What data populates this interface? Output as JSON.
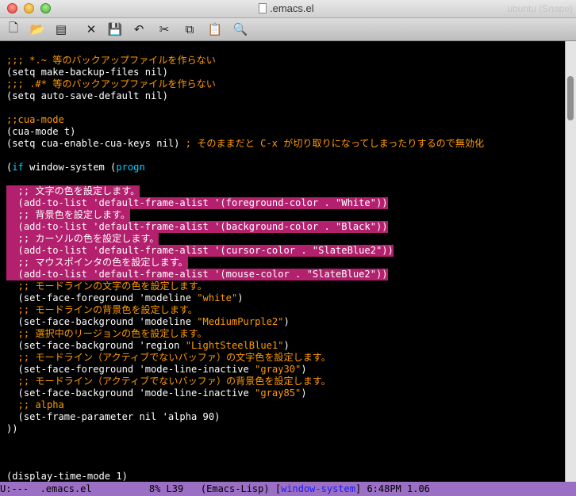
{
  "window": {
    "title": ".emacs.el",
    "ghost_text": "ubuntu (Snape)"
  },
  "toolbar": [
    {
      "name": "new-file-icon",
      "glyph": "🗋"
    },
    {
      "name": "open-folder-icon",
      "glyph": "📂"
    },
    {
      "name": "dired-icon",
      "glyph": "▤"
    },
    {
      "name": "close-buffer-icon",
      "glyph": "✕"
    },
    {
      "name": "save-icon",
      "glyph": "💾"
    },
    {
      "name": "undo-icon",
      "glyph": "↶"
    },
    {
      "name": "cut-icon",
      "glyph": "✂"
    },
    {
      "name": "copy-icon",
      "glyph": "⧉"
    },
    {
      "name": "paste-icon",
      "glyph": "📋"
    },
    {
      "name": "search-icon",
      "glyph": "🔍"
    }
  ],
  "lines": [
    [
      {
        "t": ";;; *.~ 等のバックアップファイルを作らない",
        "c": "or"
      }
    ],
    [
      {
        "t": "(setq make-backup-files nil)"
      }
    ],
    [
      {
        "t": ";;; .#* 等のバックアップファイルを作らない",
        "c": "or"
      }
    ],
    [
      {
        "t": "(setq auto-save-default nil)"
      }
    ],
    [
      {
        "t": ""
      }
    ],
    [
      {
        "t": ";;cua-mode",
        "c": "or"
      }
    ],
    [
      {
        "t": "(cua-mode t)"
      }
    ],
    [
      {
        "t": "(setq cua-enable-cua-keys nil) "
      },
      {
        "t": "; そのままだと C-x が切り取りになってしまったりするので無効化",
        "c": "or"
      }
    ],
    [
      {
        "t": ""
      }
    ],
    [
      {
        "t": "("
      },
      {
        "t": "if",
        "c": "cy"
      },
      {
        "t": " window-system ("
      },
      {
        "t": "progn",
        "c": "cy"
      }
    ],
    [
      {
        "t": ""
      }
    ],
    [
      {
        "t": "  ;; 文字の色を設定します。",
        "sel": true
      }
    ],
    [
      {
        "t": "  (add-to-list 'default-frame-alist '(foreground-color . \"White\"))",
        "sel": true
      }
    ],
    [
      {
        "t": "  ;; 背景色を設定します。",
        "sel": true
      }
    ],
    [
      {
        "t": "  (add-to-list 'default-frame-alist '(background-color . \"Black\"))",
        "sel": true
      }
    ],
    [
      {
        "t": "  ;; カーソルの色を設定します。",
        "sel": true
      }
    ],
    [
      {
        "t": "  (add-to-list 'default-frame-alist '(cursor-color . \"SlateBlue2\"))",
        "sel": true
      }
    ],
    [
      {
        "t": "  ;; マウスポインタの色を設定します。",
        "sel": true
      }
    ],
    [
      {
        "t": "  (add-to-list 'default-frame-alist '(mouse-color . \"SlateBlue2\"))",
        "sel": true
      }
    ],
    [
      {
        "t": "  ;; モードラインの文字の色を設定します。",
        "c": "or"
      }
    ],
    [
      {
        "t": "  (set-face-foreground 'modeline "
      },
      {
        "t": "\"white\"",
        "c": "or"
      },
      {
        "t": ")"
      }
    ],
    [
      {
        "t": "  ;; モードラインの背景色を設定します。",
        "c": "or"
      }
    ],
    [
      {
        "t": "  (set-face-background 'modeline "
      },
      {
        "t": "\"MediumPurple2\"",
        "c": "or"
      },
      {
        "t": ")"
      }
    ],
    [
      {
        "t": "  ;; 選択中のリージョンの色を設定します。",
        "c": "or"
      }
    ],
    [
      {
        "t": "  (set-face-background 'region "
      },
      {
        "t": "\"LightSteelBlue1\"",
        "c": "or"
      },
      {
        "t": ")"
      }
    ],
    [
      {
        "t": "  ;; モードライン（アクティブでないバッファ）の文字色を設定します。",
        "c": "or"
      }
    ],
    [
      {
        "t": "  (set-face-foreground 'mode-line-inactive "
      },
      {
        "t": "\"gray30\"",
        "c": "or"
      },
      {
        "t": ")"
      }
    ],
    [
      {
        "t": "  ;; モードライン（アクティブでないバッファ）の背景色を設定します。",
        "c": "or"
      }
    ],
    [
      {
        "t": "  (set-face-background 'mode-line-inactive "
      },
      {
        "t": "\"gray85\"",
        "c": "or"
      },
      {
        "t": ")"
      }
    ],
    [
      {
        "t": "  ;; alpha",
        "c": "or"
      }
    ],
    [
      {
        "t": "  (set-frame-parameter nil 'alpha 90)"
      }
    ],
    [
      {
        "t": "))"
      }
    ],
    [
      {
        "t": ""
      }
    ],
    [
      {
        "t": ""
      }
    ],
    [
      {
        "t": ""
      }
    ],
    [
      {
        "t": "(display-time-mode 1)"
      }
    ]
  ],
  "modeline": {
    "status": "U:---",
    "buffer": ".emacs.el",
    "position": "8% L39",
    "mode": "(Emacs-Lisp)",
    "minor": "window-system",
    "time": "6:48PM 1.06"
  },
  "colors": {
    "comment": "#ff9a00",
    "keyword": "#00d0ff",
    "selection": "#b3206e",
    "modeline": "#9b6fc3"
  }
}
